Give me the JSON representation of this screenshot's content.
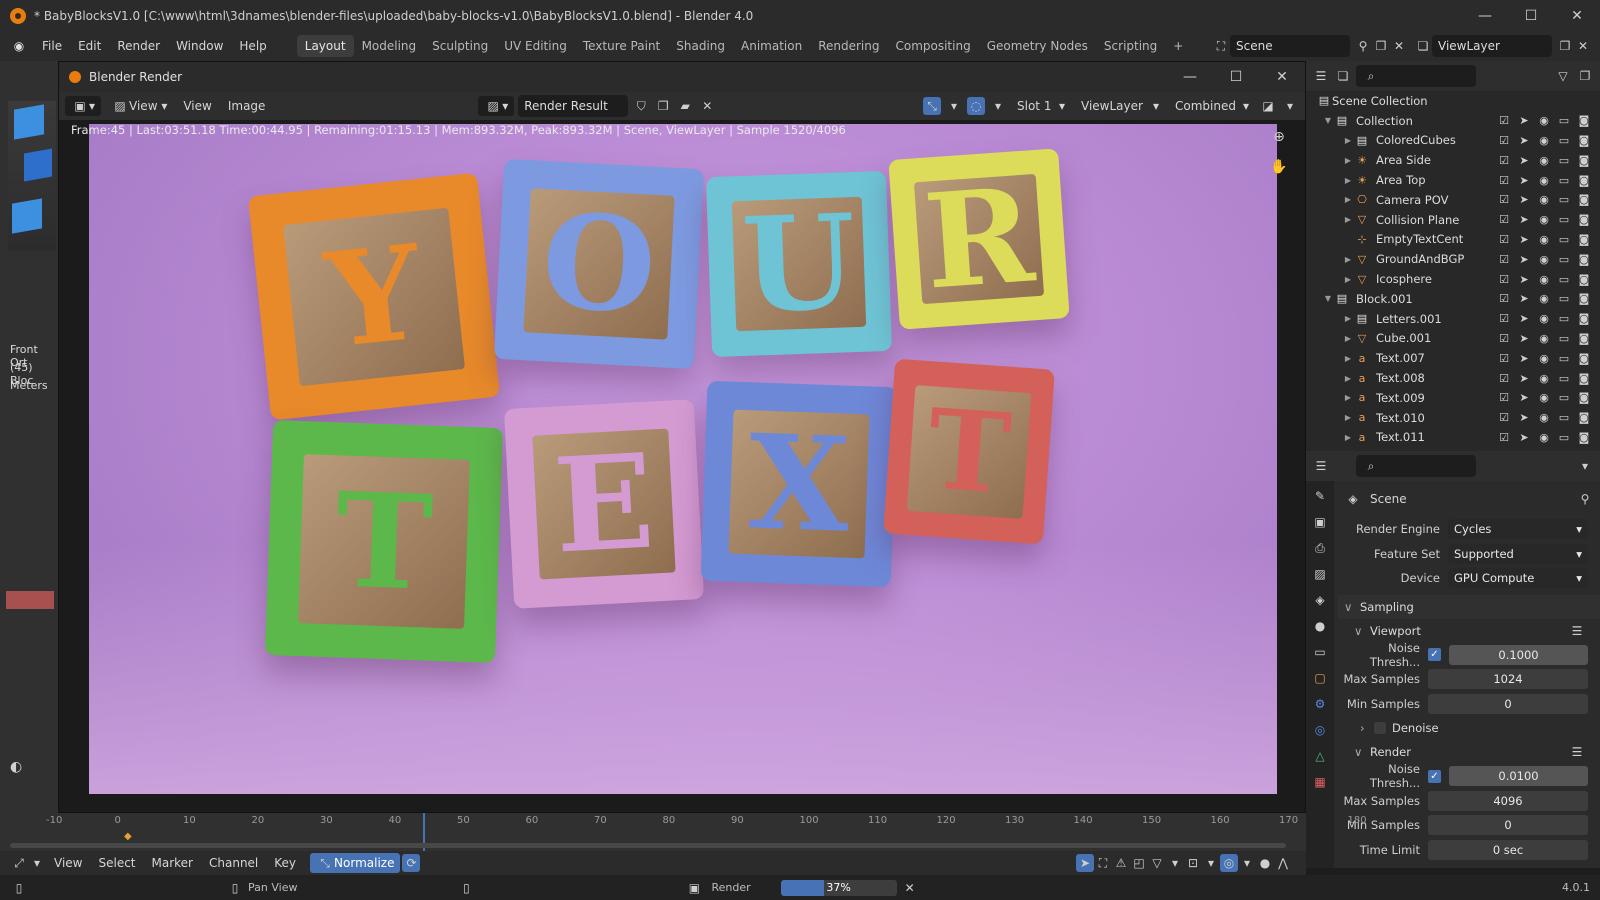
{
  "titlebar": {
    "title": "* BabyBlocksV1.0 [C:\\www\\html\\3dnames\\blender-files\\uploaded\\baby-blocks-v1.0\\BabyBlocksV1.0.blend] - Blender 4.0",
    "min": "—",
    "max": "☐",
    "close": "✕"
  },
  "menu": {
    "items": [
      "File",
      "Edit",
      "Render",
      "Window",
      "Help"
    ],
    "workspaces": [
      "Layout",
      "Modeling",
      "Sculpting",
      "UV Editing",
      "Texture Paint",
      "Shading",
      "Animation",
      "Rendering",
      "Compositing",
      "Geometry Nodes",
      "Scripting"
    ],
    "add": "+",
    "scene": "Scene",
    "viewlayer": "ViewLayer"
  },
  "render_window": {
    "title": "Blender Render",
    "header": {
      "view1": "View",
      "view2": "View",
      "image": "Image",
      "result": "Render Result",
      "slot": "Slot 1",
      "layer": "ViewLayer",
      "pass": "Combined"
    },
    "stats": "Frame:45 | Last:03:51.18 Time:00:44.95 | Remaining:01:15.13 | Mem:893.32M, Peak:893.32M | Scene, ViewLayer | Sample 1520/4096",
    "letters": {
      "top": [
        "Y",
        "O",
        "U",
        "R"
      ],
      "bottom": [
        "T",
        "E",
        "X",
        "T"
      ]
    },
    "colors": {
      "bg_top": "#b88ad6",
      "bg_bottom": "#d4a8e0",
      "orange": "#e88a2a",
      "blue": "#7d9ae0",
      "teal": "#6ec4d4",
      "yellow": "#dcdc5a",
      "green": "#5cb84a",
      "pink": "#d49ad2",
      "periwinkle": "#6e88d8",
      "red": "#d4605a"
    }
  },
  "left": {
    "front": "Front Ort",
    "line2": "(45) Bloc",
    "line3": "Meters"
  },
  "outliner": {
    "root": "Scene Collection",
    "rows": [
      {
        "name": "Collection",
        "depth": 0,
        "icon": "collection",
        "tri": "▼"
      },
      {
        "name": "ColoredCubes",
        "depth": 1,
        "icon": "collection",
        "tri": "▶"
      },
      {
        "name": "Area Side",
        "depth": 1,
        "icon": "light",
        "tri": "▶"
      },
      {
        "name": "Area Top",
        "depth": 1,
        "icon": "light",
        "tri": "▶"
      },
      {
        "name": "Camera POV",
        "depth": 1,
        "icon": "camera",
        "tri": "▶"
      },
      {
        "name": "Collision Plane",
        "depth": 1,
        "icon": "mesh",
        "tri": "▶"
      },
      {
        "name": "EmptyTextCent",
        "depth": 1,
        "icon": "empty",
        "tri": ""
      },
      {
        "name": "GroundAndBGP",
        "depth": 1,
        "icon": "mesh",
        "tri": "▶"
      },
      {
        "name": "Icosphere",
        "depth": 1,
        "icon": "mesh",
        "tri": "▶"
      },
      {
        "name": "Block.001",
        "depth": 0,
        "icon": "collection",
        "tri": "▼"
      },
      {
        "name": "Letters.001",
        "depth": 1,
        "icon": "collection",
        "tri": "▶"
      },
      {
        "name": "Cube.001",
        "depth": 1,
        "icon": "mesh",
        "tri": "▶"
      },
      {
        "name": "Text.007",
        "depth": 1,
        "icon": "text",
        "tri": "▶"
      },
      {
        "name": "Text.008",
        "depth": 1,
        "icon": "text",
        "tri": "▶"
      },
      {
        "name": "Text.009",
        "depth": 1,
        "icon": "text",
        "tri": "▶"
      },
      {
        "name": "Text.010",
        "depth": 1,
        "icon": "text",
        "tri": "▶"
      },
      {
        "name": "Text.011",
        "depth": 1,
        "icon": "text",
        "tri": "▶"
      }
    ]
  },
  "properties": {
    "context": "Scene",
    "engine_label": "Render Engine",
    "engine": "Cycles",
    "feature_label": "Feature Set",
    "feature": "Supported",
    "device_label": "Device",
    "device": "GPU Compute",
    "sampling": "Sampling",
    "viewport": "Viewport",
    "noise_label": "Noise Thresh...",
    "v_noise": "0.1000",
    "max_label": "Max Samples",
    "v_max": "1024",
    "min_label": "Min Samples",
    "v_min": "0",
    "denoise": "Denoise",
    "render": "Render",
    "r_noise": "0.0100",
    "r_max": "4096",
    "r_min": "0",
    "time_label": "Time Limit",
    "r_time": "0 sec"
  },
  "timeline": {
    "ticks": [
      "-10",
      "0",
      "10",
      "20",
      "30",
      "40",
      "50",
      "60",
      "70",
      "80",
      "90",
      "100",
      "110",
      "120",
      "130",
      "140",
      "150",
      "160",
      "170",
      "180"
    ],
    "playhead_frame": 45
  },
  "tlbar": {
    "items": [
      "View",
      "Select",
      "Marker",
      "Channel",
      "Key"
    ],
    "normalize": "Normalize"
  },
  "status": {
    "pan": "Pan View",
    "render": "Render",
    "progress": "37%",
    "progress_value": 0.37,
    "version": "4.0.1"
  }
}
